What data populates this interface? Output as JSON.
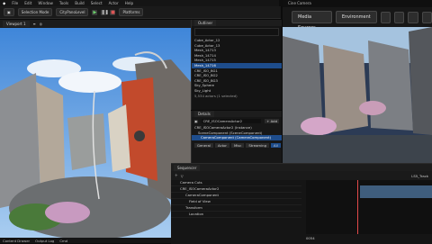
{
  "menu": [
    "File",
    "Edit",
    "Window",
    "Tools",
    "Build",
    "Select",
    "Actor",
    "Help"
  ],
  "toolbar": {
    "selection_mode": "Selection Mode",
    "platforms": "Platforms",
    "level_name": "CityPanoLevel"
  },
  "viewport": {
    "tab": "Viewport 1"
  },
  "outliner": {
    "tab": "Outliner",
    "items": [
      "Cube_Actor_12",
      "Cube_Actor_13",
      "Mesh_14713",
      "Mesh_14714",
      "Mesh_14715",
      "Mesh_14716",
      "CRE_ISO_BG1",
      "CRE_ISO_BG2",
      "CRE_ISO_BG3",
      "Sky_Sphere",
      "Sky_Light"
    ],
    "selected_index": 5,
    "footer": "5,534 actors (1 selected)"
  },
  "details": {
    "tab": "Details",
    "actor": "CRE_ISOCameraActor2",
    "add": "+ Add",
    "components": [
      "CRE_ISOCameraActor2 (Instance)",
      "SceneComponent (SceneComponent)",
      "CameraComponent (CameraComponent)"
    ],
    "filters": [
      "General",
      "Actor",
      "Misc",
      "Streaming",
      "All"
    ]
  },
  "cine": {
    "title": "Cine Camera",
    "media_sources": "Media Sources",
    "environment": "Environment"
  },
  "sequencer": {
    "tab": "Sequencer",
    "tracks": [
      "Camera Cuts",
      "CRE_ISOCameraActor2",
      "CameraComponent",
      "Field of View",
      "Transform",
      "Location"
    ],
    "fps": "LS5_Track",
    "frame": "0054"
  },
  "bottom": {
    "content_drawer": "Content Drawer",
    "output_log": "Output Log",
    "cmd": "Cmd"
  }
}
